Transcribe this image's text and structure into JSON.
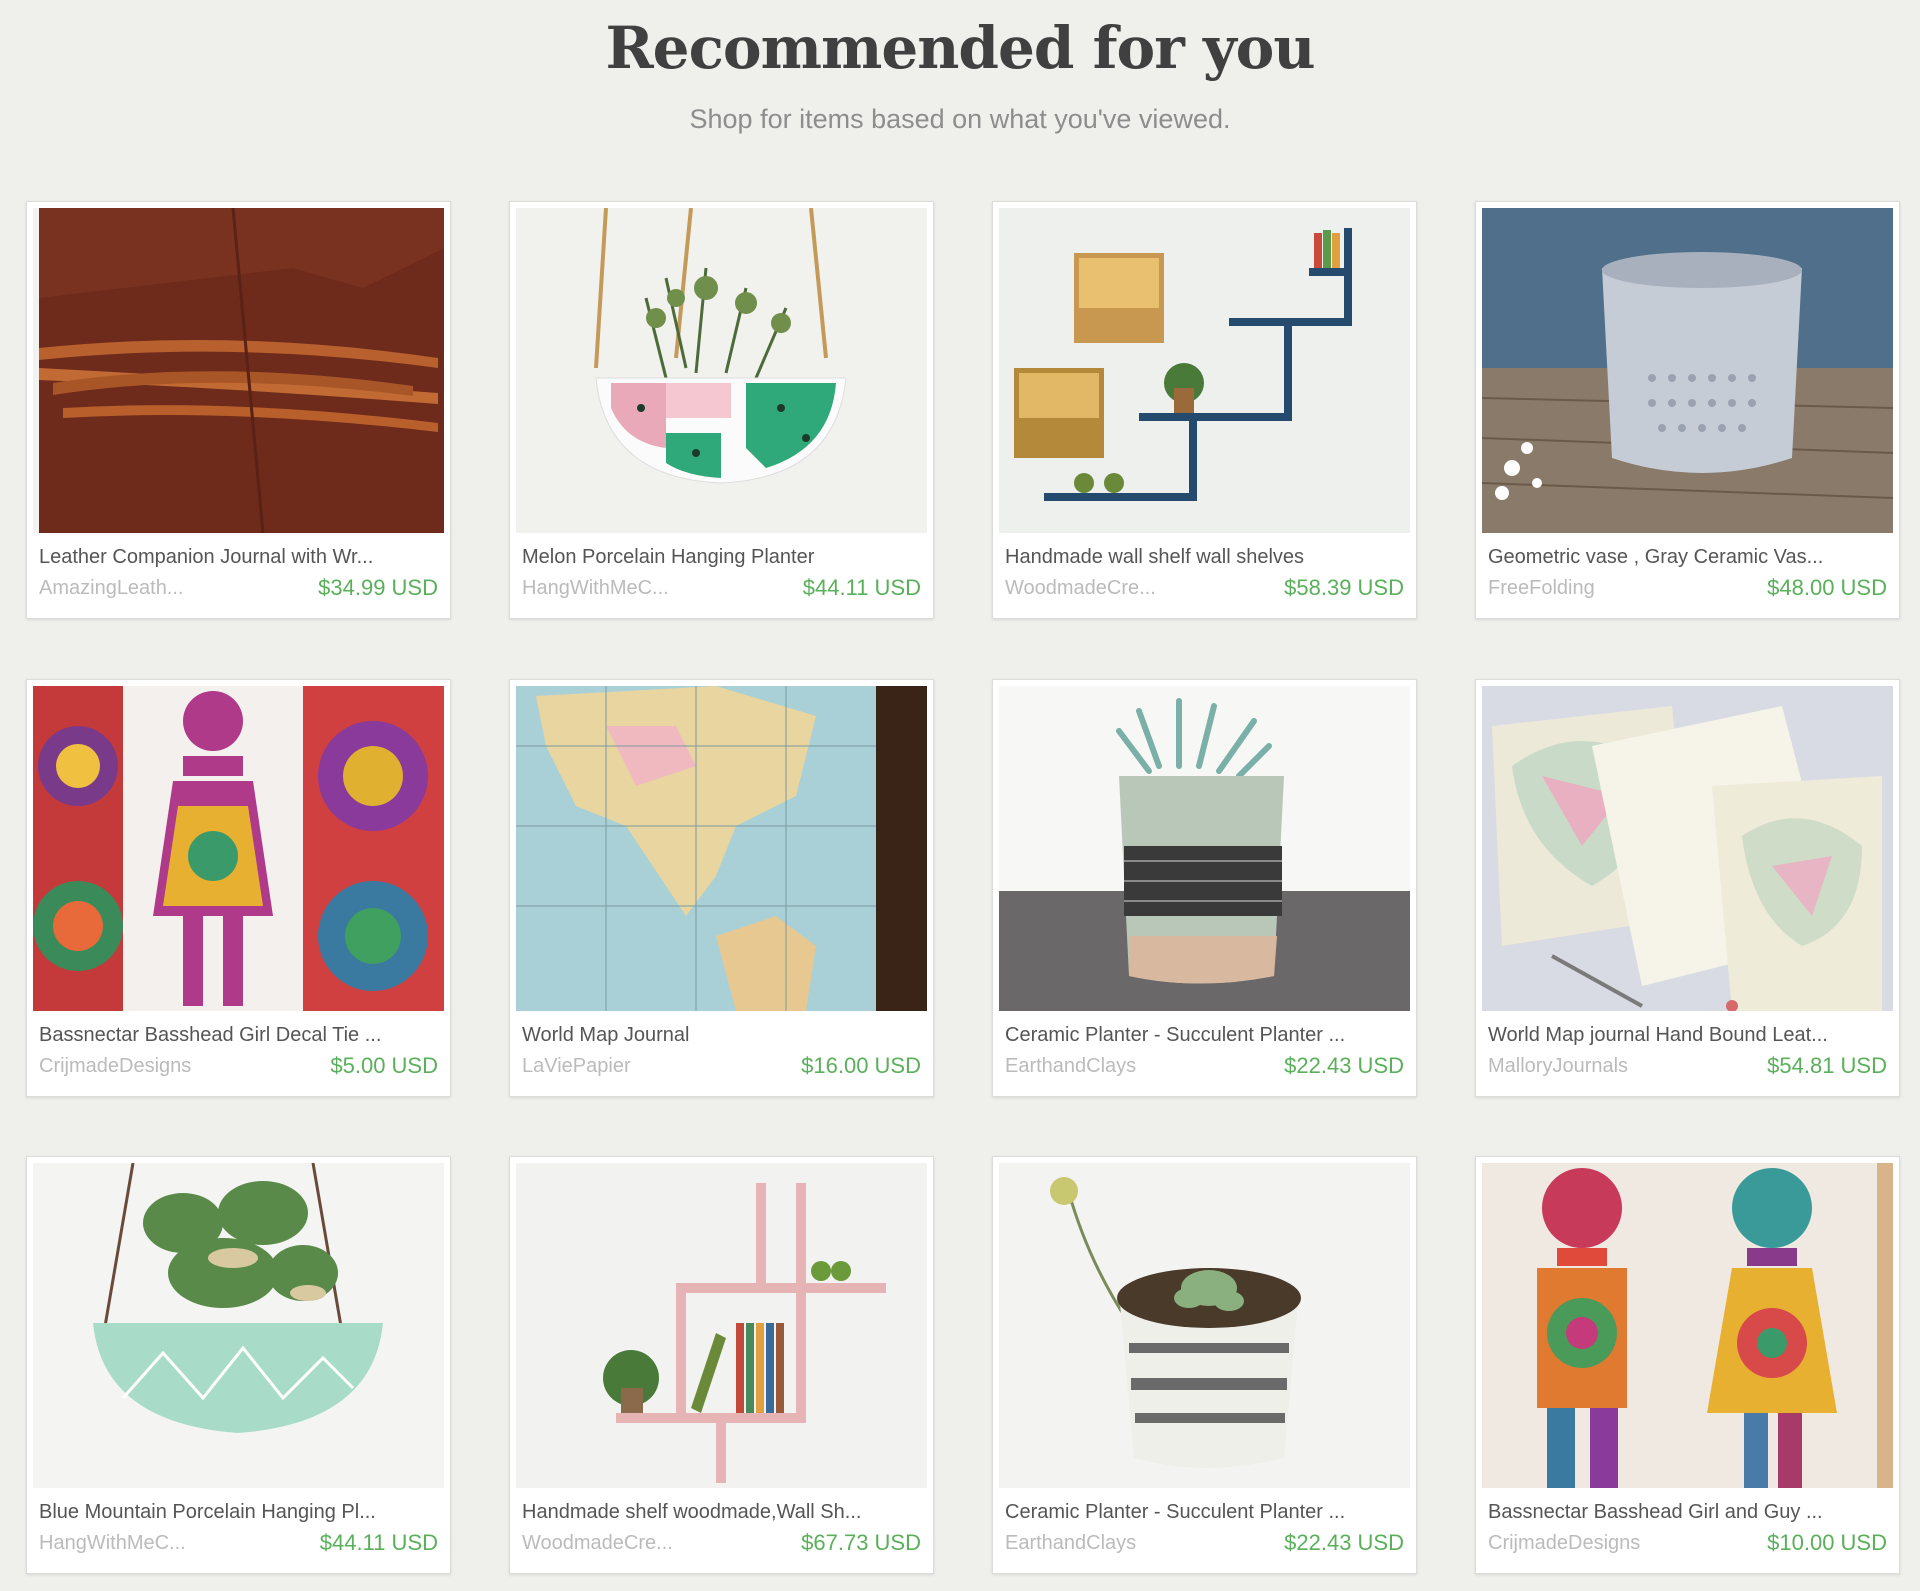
{
  "header": {
    "title": "Recommended for you",
    "subtitle": "Shop for items based on what you've viewed."
  },
  "items": [
    {
      "title": "Leather Companion Journal with Wr...",
      "shop": "AmazingLeath...",
      "price": "$34.99 USD",
      "image": "leather-journal-image"
    },
    {
      "title": "Melon Porcelain Hanging Planter",
      "shop": "HangWithMeC...",
      "price": "$44.11 USD",
      "image": "melon-planter-image"
    },
    {
      "title": "Handmade wall shelf wall shelves",
      "shop": "WoodmadeCre...",
      "price": "$58.39 USD",
      "image": "wall-shelf-image"
    },
    {
      "title": "Geometric vase , Gray Ceramic Vas...",
      "shop": "FreeFolding",
      "price": "$48.00 USD",
      "image": "geometric-vase-image"
    },
    {
      "title": "Bassnectar Basshead Girl Decal Tie ...",
      "shop": "CrijmadeDesigns",
      "price": "$5.00 USD",
      "image": "tie-dye-decal-image"
    },
    {
      "title": "World Map Journal",
      "shop": "LaViePapier",
      "price": "$16.00 USD",
      "image": "world-map-journal-image"
    },
    {
      "title": "Ceramic Planter - Succulent Planter ...",
      "shop": "EarthandClays",
      "price": "$22.43 USD",
      "image": "ceramic-planter-image"
    },
    {
      "title": "World Map journal Hand Bound Leat...",
      "shop": "MalloryJournals",
      "price": "$54.81 USD",
      "image": "map-journal-leather-image"
    },
    {
      "title": "Blue Mountain Porcelain Hanging Pl...",
      "shop": "HangWithMeC...",
      "price": "$44.11 USD",
      "image": "blue-mountain-planter-image"
    },
    {
      "title": "Handmade shelf woodmade,Wall Sh...",
      "shop": "WoodmadeCre...",
      "price": "$67.73 USD",
      "image": "pink-shelf-image"
    },
    {
      "title": "Ceramic Planter - Succulent Planter ...",
      "shop": "EarthandClays",
      "price": "$22.43 USD",
      "image": "striped-planter-image"
    },
    {
      "title": "Bassnectar Basshead Girl and Guy ...",
      "shop": "CrijmadeDesigns",
      "price": "$10.00 USD",
      "image": "tie-dye-pair-image"
    }
  ]
}
